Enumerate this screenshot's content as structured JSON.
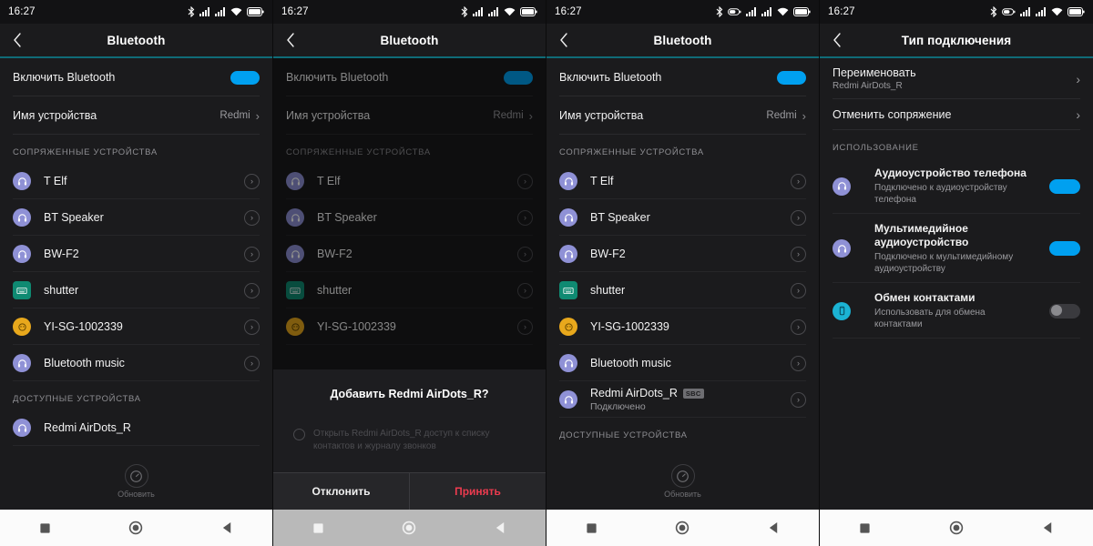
{
  "statusbar": {
    "time": "16:27",
    "icons_basic": [
      "bluetooth-icon",
      "signal-icon",
      "signal-icon",
      "wifi-icon",
      "battery-icon"
    ],
    "icons_with_headset": [
      "bluetooth-icon",
      "headset-battery-icon",
      "signal-icon",
      "signal-icon",
      "wifi-icon",
      "battery-icon"
    ]
  },
  "common": {
    "chevron": "›",
    "chevron_small": "›",
    "refresh_label": "Обновить",
    "toggle_on_color": "#00a0f0",
    "toggle_off_color": "#3a3a3e",
    "accent_color": "#0f6b77",
    "accept_color": "#ec3b4f"
  },
  "panel1": {
    "title": "Bluetooth",
    "enable_label": "Включить Bluetooth",
    "enable_state": "on",
    "device_name_label": "Имя устройства",
    "device_name_value": "Redmi",
    "paired_header": "СОПРЯЖЕННЫЕ УСТРОЙСТВА",
    "available_header": "ДОСТУПНЫЕ УСТРОЙСТВА",
    "paired": [
      {
        "name": "T Elf",
        "icon": "headset-icon",
        "icon_kind": "headset"
      },
      {
        "name": "BT Speaker",
        "icon": "headset-icon",
        "icon_kind": "headset"
      },
      {
        "name": "BW-F2",
        "icon": "headset-icon",
        "icon_kind": "headset"
      },
      {
        "name": "shutter",
        "icon": "keyboard-icon",
        "icon_kind": "keyboard"
      },
      {
        "name": "YI-SG-1002339",
        "icon": "camera-icon",
        "icon_kind": "camera"
      },
      {
        "name": "Bluetooth music",
        "icon": "headset-icon",
        "icon_kind": "headset"
      }
    ],
    "available": [
      {
        "name": "Redmi AirDots_R",
        "icon": "headset-icon",
        "icon_kind": "headset"
      }
    ]
  },
  "panel2": {
    "title": "Bluetooth",
    "enable_label": "Включить Bluetooth",
    "enable_state": "on",
    "device_name_label": "Имя устройства",
    "device_name_value": "Redmi",
    "paired_header": "СОПРЯЖЕННЫЕ УСТРОЙСТВА",
    "paired": [
      {
        "name": "T Elf",
        "icon_kind": "headset"
      },
      {
        "name": "BT Speaker",
        "icon_kind": "headset"
      },
      {
        "name": "BW-F2",
        "icon_kind": "headset"
      },
      {
        "name": "shutter",
        "icon_kind": "keyboard"
      },
      {
        "name": "YI-SG-1002339",
        "icon_kind": "camera"
      }
    ],
    "dialog": {
      "title": "Добавить Redmi AirDots_R?",
      "checkbox_text": "Открыть Redmi AirDots_R доступ к списку контактов и журналу звонков",
      "checkbox_state": "unchecked",
      "decline_label": "Отклонить",
      "accept_label": "Принять"
    }
  },
  "panel3": {
    "title": "Bluetooth",
    "enable_label": "Включить Bluetooth",
    "enable_state": "on",
    "device_name_label": "Имя устройства",
    "device_name_value": "Redmi",
    "paired_header": "СОПРЯЖЕННЫЕ УСТРОЙСТВА",
    "available_header": "ДОСТУПНЫЕ УСТРОЙСТВА",
    "paired": [
      {
        "name": "T Elf",
        "icon_kind": "headset",
        "sub": "",
        "badge": ""
      },
      {
        "name": "BT Speaker",
        "icon_kind": "headset",
        "sub": "",
        "badge": ""
      },
      {
        "name": "BW-F2",
        "icon_kind": "headset",
        "sub": "",
        "badge": ""
      },
      {
        "name": "shutter",
        "icon_kind": "keyboard",
        "sub": "",
        "badge": ""
      },
      {
        "name": "YI-SG-1002339",
        "icon_kind": "camera",
        "sub": "",
        "badge": ""
      },
      {
        "name": "Bluetooth music",
        "icon_kind": "headset",
        "sub": "",
        "badge": ""
      },
      {
        "name": "Redmi AirDots_R",
        "icon_kind": "headset",
        "sub": "Подключено",
        "badge": "SBC"
      }
    ]
  },
  "panel4": {
    "title": "Тип подключения",
    "rename_label": "Переименовать",
    "rename_value": "Redmi AirDots_R",
    "unpair_label": "Отменить сопряжение",
    "usage_header": "ИСПОЛЬЗОВАНИЕ",
    "usage": [
      {
        "title": "Аудиоустройство телефона",
        "sub": "Подключено к аудиоустройству телефона",
        "icon_kind": "headset",
        "state": "on"
      },
      {
        "title": "Мультимедийное аудиоустройство",
        "sub": "Подключено к мультимедийному аудиоустройству",
        "icon_kind": "headset",
        "state": "on"
      },
      {
        "title": "Обмен контактами",
        "sub": "Использовать для обмена контактами",
        "icon_kind": "phone",
        "state": "off"
      }
    ]
  },
  "navbar": {
    "recents": "recents-square-icon",
    "home": "home-circle-icon",
    "back": "back-triangle-icon"
  }
}
